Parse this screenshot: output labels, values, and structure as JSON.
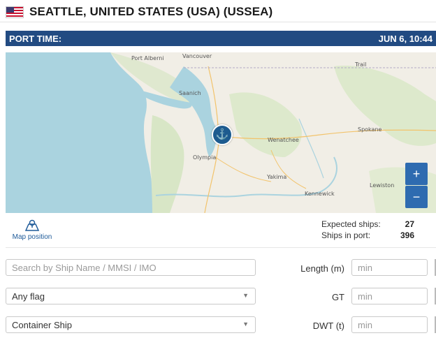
{
  "header": {
    "title": "SEATTLE, UNITED STATES (USA) (USSEA)",
    "flag_icon": "us-flag-icon"
  },
  "port_time": {
    "label": "PORT TIME:",
    "value": "JUN 6, 10:44"
  },
  "map": {
    "labels": {
      "port_alberni": "Port Alberni",
      "vancouver": "Vancouver",
      "trail": "Trail",
      "saanich": "Saanich",
      "spokane": "Spokane",
      "wenatchee": "Wenatchee",
      "olympia": "Olympia",
      "yakima": "Yakima",
      "lewiston": "Lewiston",
      "kennewick": "Kennewick"
    },
    "zoom_in": "+",
    "zoom_out": "−",
    "pin_icon": "anchor-icon",
    "pin_glyph": "⚓"
  },
  "map_position": {
    "label": "Map position",
    "icon": "map-pin-icon"
  },
  "stats": {
    "expected_label": "Expected ships:",
    "expected_value": "27",
    "in_port_label": "Ships in port:",
    "in_port_value": "396"
  },
  "filters": {
    "search_placeholder": "Search by Ship Name / MMSI / IMO",
    "flag_value": "Any flag",
    "type_value": "Container Ship",
    "length_label": "Length (m)",
    "length_placeholder": "min",
    "gt_label": "GT",
    "gt_placeholder": "min",
    "dwt_label": "DWT (t)",
    "dwt_placeholder": "min",
    "dropdown_icon": "chevron-down-icon"
  },
  "colors": {
    "bar": "#224b82",
    "water": "#aad3df",
    "land": "#f1eee6",
    "zoom": "#2e6bb0",
    "pin": "#1d5b8f"
  }
}
